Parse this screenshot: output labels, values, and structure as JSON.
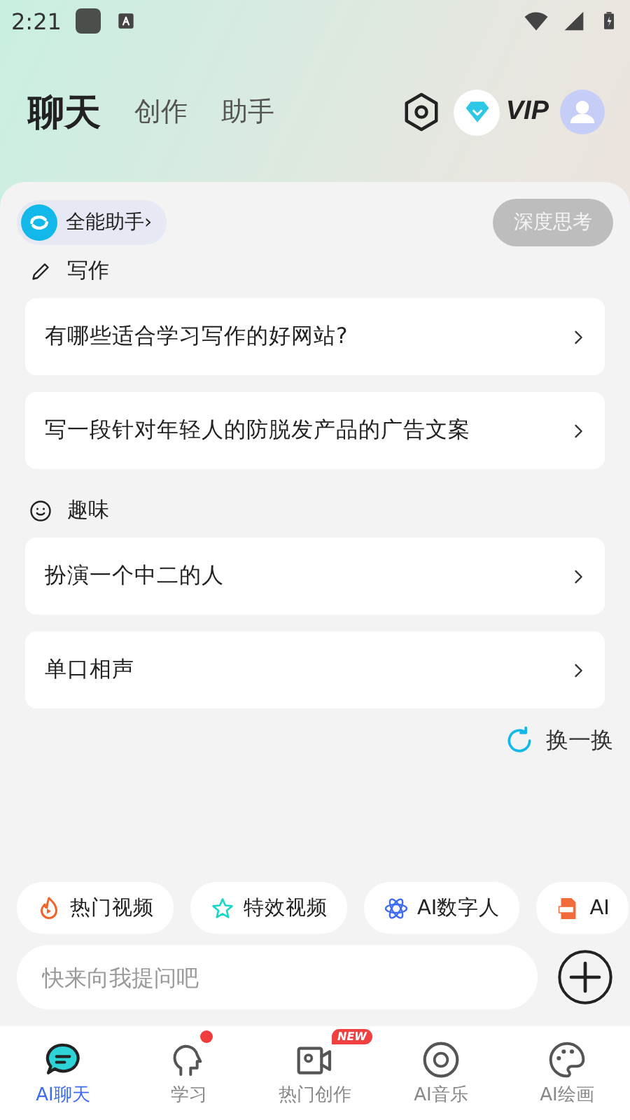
{
  "status_bar": {
    "time": "2:21"
  },
  "top_tabs": [
    {
      "label": "聊天",
      "selected": true
    },
    {
      "label": "创作",
      "selected": false
    },
    {
      "label": "助手",
      "selected": false
    }
  ],
  "vip": {
    "label": "VIP"
  },
  "assistant": {
    "label": "全能助手",
    "chevron": "›"
  },
  "deep_think": {
    "label": "深度思考",
    "on": false
  },
  "sections": [
    {
      "kind": "writing",
      "title": "写作",
      "prompts": [
        "有哪些适合学习写作的好网站?",
        "写一段针对年轻人的防脱发产品的广告文案"
      ]
    },
    {
      "kind": "fun",
      "title": "趣味",
      "prompts": [
        "扮演一个中二的人",
        "单口相声"
      ]
    }
  ],
  "refresh": {
    "label": "换一换"
  },
  "chips": [
    {
      "kind": "fire",
      "label": "热门视频"
    },
    {
      "kind": "star",
      "label": "特效视频"
    },
    {
      "kind": "atom",
      "label": "AI数字人"
    },
    {
      "kind": "ppt",
      "label": "AI"
    }
  ],
  "input": {
    "placeholder": "快来向我提问吧"
  },
  "nav": [
    {
      "kind": "chat",
      "label": "AI聊天",
      "selected": true
    },
    {
      "kind": "learn",
      "label": "学习",
      "selected": false,
      "dot": true
    },
    {
      "kind": "video",
      "label": "热门创作",
      "selected": false,
      "badge": "NEW"
    },
    {
      "kind": "music",
      "label": "AI音乐",
      "selected": false
    },
    {
      "kind": "palette",
      "label": "AI绘画",
      "selected": false
    }
  ]
}
